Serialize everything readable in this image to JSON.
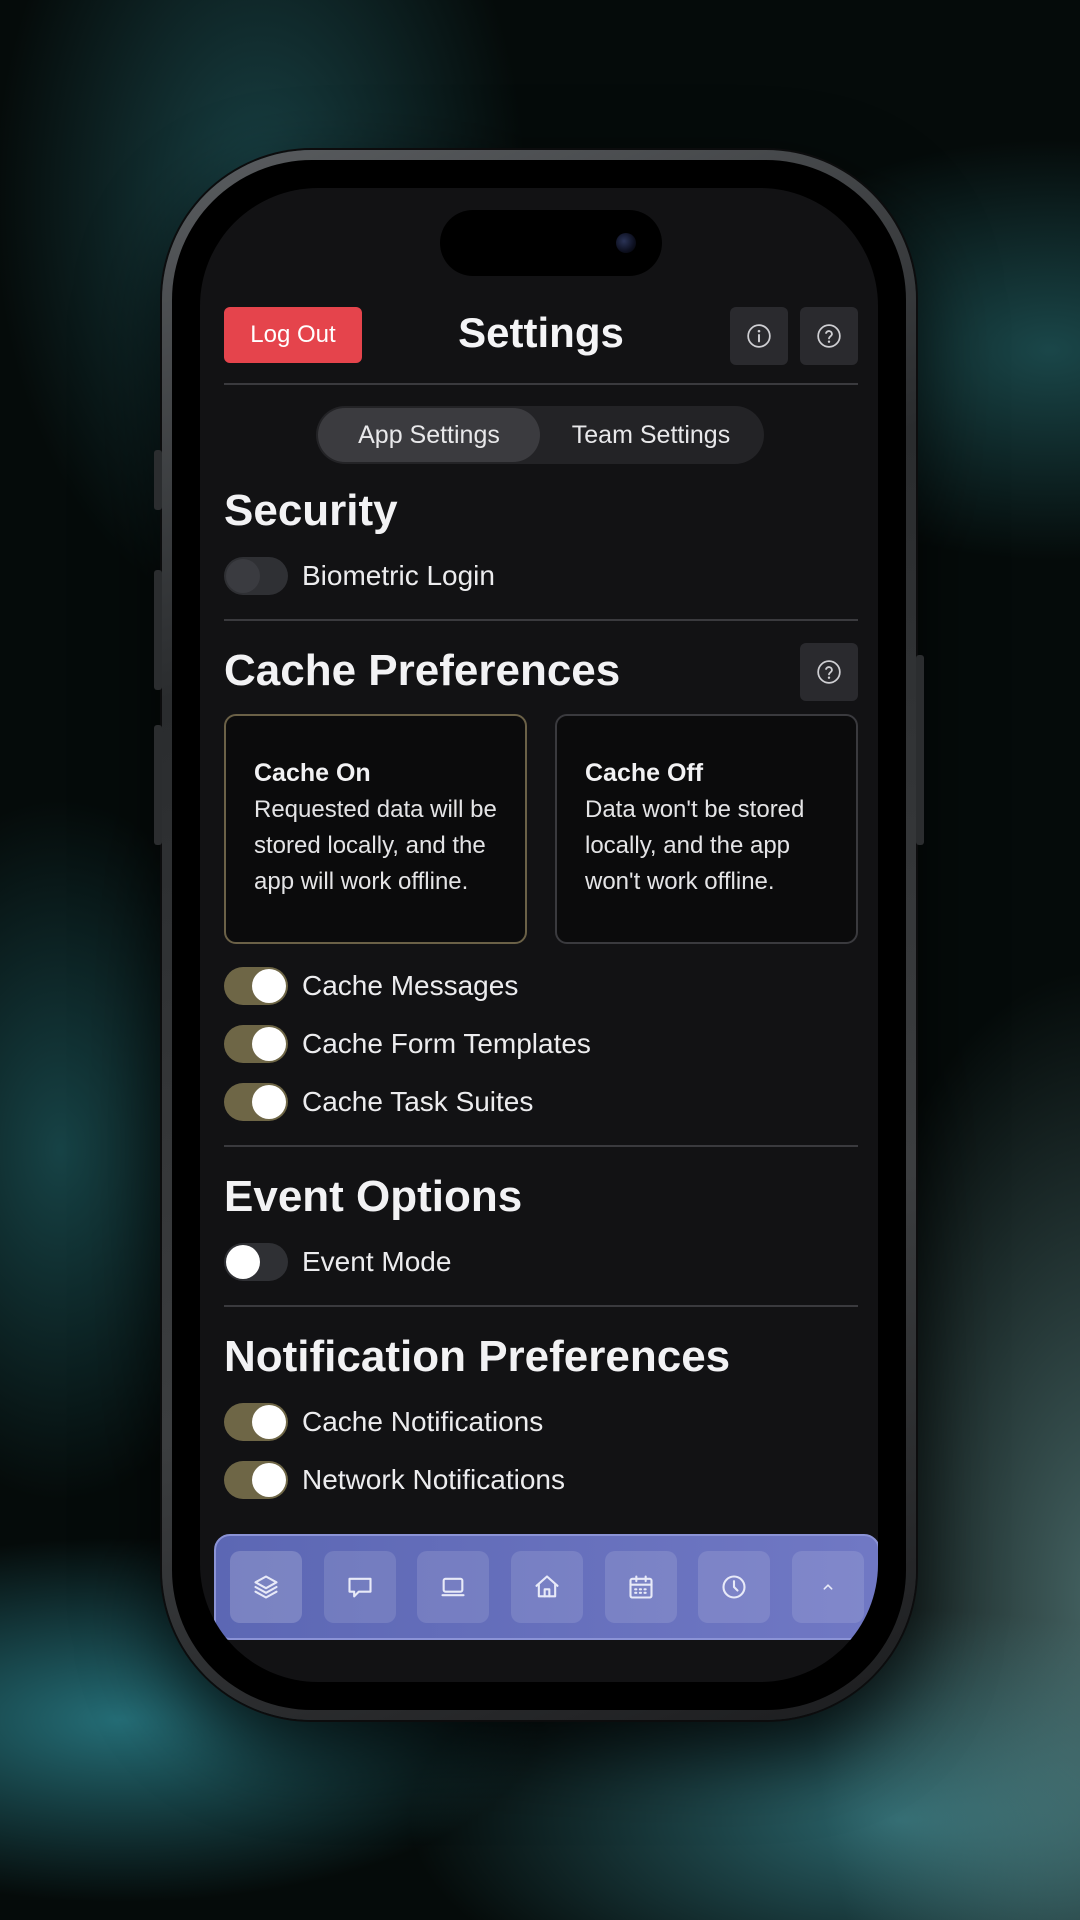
{
  "header": {
    "logout_label": "Log Out",
    "title": "Settings",
    "info_icon": "info-icon",
    "help_icon": "help-icon"
  },
  "tabs": [
    {
      "label": "App Settings",
      "active": true
    },
    {
      "label": "Team Settings",
      "active": false
    }
  ],
  "security": {
    "title": "Security",
    "toggles": [
      {
        "label": "Biometric Login",
        "state": "disabled"
      }
    ]
  },
  "cache": {
    "title": "Cache Preferences",
    "help_icon": "help-icon",
    "options": [
      {
        "title": "Cache On",
        "description": "Requested data will be stored locally, and the app will work offline.",
        "selected": true
      },
      {
        "title": "Cache Off",
        "description": "Data won't be stored locally, and the app won't work offline.",
        "selected": false
      }
    ],
    "toggles": [
      {
        "label": "Cache Messages",
        "state": "on"
      },
      {
        "label": "Cache Form Templates",
        "state": "on"
      },
      {
        "label": "Cache Task Suites",
        "state": "on"
      }
    ]
  },
  "events": {
    "title": "Event Options",
    "toggles": [
      {
        "label": "Event Mode",
        "state": "off"
      }
    ]
  },
  "notifications": {
    "title": "Notification Preferences",
    "toggles": [
      {
        "label": "Cache Notifications",
        "state": "on"
      },
      {
        "label": "Network Notifications",
        "state": "on"
      }
    ]
  },
  "nav": {
    "items": [
      "layers-icon",
      "chat-icon",
      "laptop-icon",
      "home-icon",
      "calendar-icon",
      "clock-icon",
      "chevron-up-icon"
    ]
  },
  "colors": {
    "logout": "#e5444c",
    "toggle_on": "#6e6646",
    "nav_bar": "#6670bc"
  }
}
